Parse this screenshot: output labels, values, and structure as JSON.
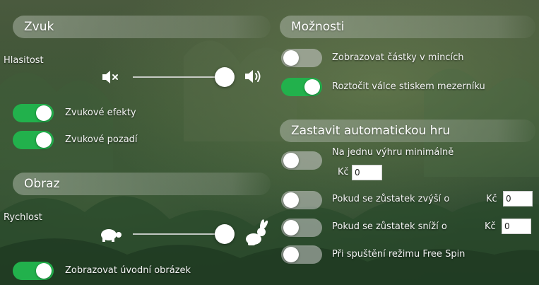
{
  "sound": {
    "title": "Zvuk",
    "volume_label": "Hlasitost",
    "volume_level": 1.0,
    "effects": {
      "label": "Zvukové efekty",
      "on": true
    },
    "background": {
      "label": "Zvukové pozadí",
      "on": true
    }
  },
  "display": {
    "title": "Obraz",
    "speed_label": "Rychlost",
    "speed_level": 1.0,
    "intro": {
      "label": "Zobrazovat úvodní obrázek",
      "on": true
    }
  },
  "options": {
    "title": "Možnosti",
    "coins": {
      "label": "Zobrazovat částky v mincích",
      "on": false
    },
    "space_spin": {
      "label": "Roztočit válce stiskem mezerníku",
      "on": true
    }
  },
  "autoplay": {
    "title": "Zastavit automatickou hru",
    "single_win": {
      "label": "Na jednu výhru minimálně",
      "currency": "Kč",
      "value": "0",
      "on": false
    },
    "balance_up": {
      "label": "Pokud se zůstatek zvýší o",
      "currency": "Kč",
      "value": "0",
      "on": false
    },
    "balance_down": {
      "label": "Pokud se zůstatek sníží o",
      "currency": "Kč",
      "value": "0",
      "on": false
    },
    "free_spin": {
      "label": "Při spuštění režimu Free Spin",
      "on": false
    }
  },
  "icons": {
    "mute": "speaker-mute-icon",
    "volume": "speaker-volume-icon",
    "slow": "turtle-icon",
    "fast": "rabbit-icon"
  },
  "colors": {
    "toggle_on": "#22b14c",
    "toggle_off": "#cdcdcd"
  }
}
